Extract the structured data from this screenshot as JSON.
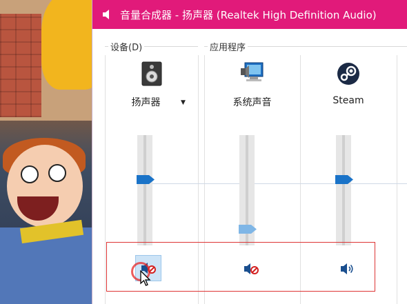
{
  "window": {
    "title": "音量合成器 - 扬声器 (Realtek High Definition Audio)",
    "title_bar_color": "#e11a7a"
  },
  "groups": {
    "device_label": "设备(D)",
    "apps_label": "应用程序"
  },
  "channels": [
    {
      "id": "speaker",
      "label": "扬声器",
      "icon": "speaker-device-icon",
      "has_dropdown": true,
      "volume": 0.6,
      "muted": true
    },
    {
      "id": "system-sounds",
      "label": "系统声音",
      "icon": "system-sounds-icon",
      "has_dropdown": false,
      "volume": 0.15,
      "muted": true
    },
    {
      "id": "steam",
      "label": "Steam",
      "icon": "steam-icon",
      "has_dropdown": false,
      "volume": 0.6,
      "muted": false
    }
  ],
  "colors": {
    "thumb": "#1a73c8",
    "highlight_box": "#dd3333"
  }
}
